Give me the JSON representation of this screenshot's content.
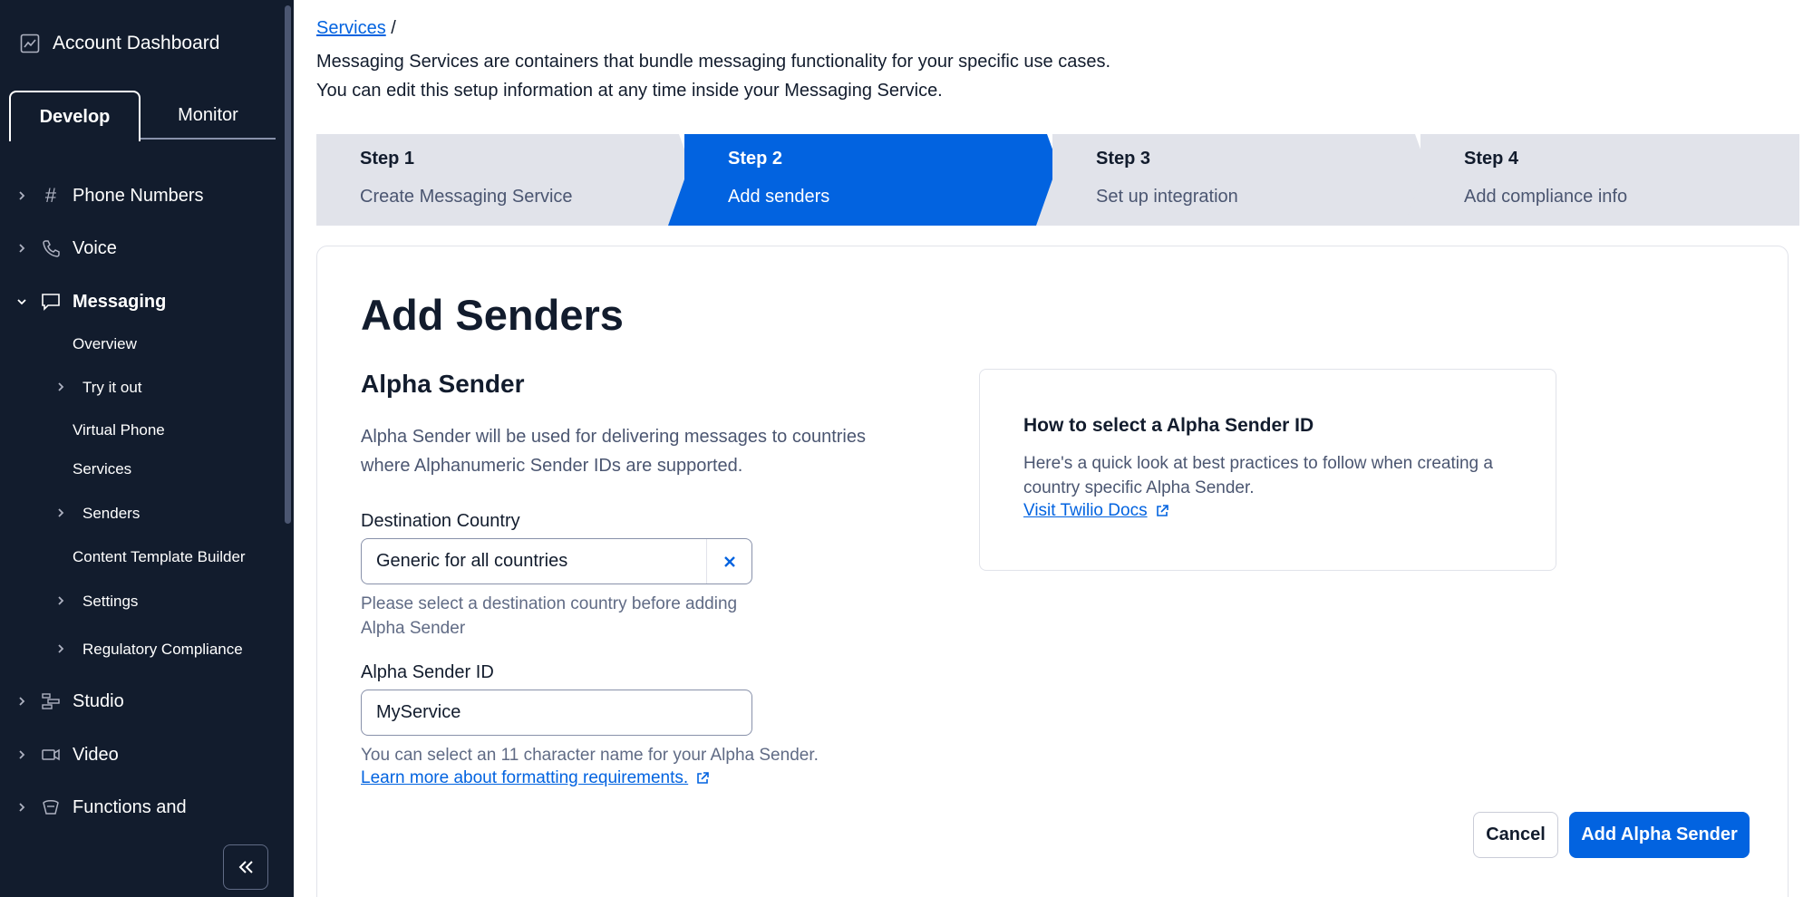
{
  "sidebar": {
    "account_label": "Account Dashboard",
    "tabs": [
      {
        "label": "Develop"
      },
      {
        "label": "Monitor"
      }
    ],
    "items": [
      {
        "label": "Phone Numbers",
        "icon": "hash-icon"
      },
      {
        "label": "Voice",
        "icon": "phone-icon"
      },
      {
        "label": "Messaging",
        "icon": "chat-icon"
      },
      {
        "label": "Studio",
        "icon": "studio-icon"
      },
      {
        "label": "Video",
        "icon": "video-icon"
      },
      {
        "label": "Functions and",
        "icon": "functions-icon"
      }
    ],
    "messaging_sub": [
      {
        "label": "Overview"
      },
      {
        "label": "Try it out"
      },
      {
        "label": "Virtual Phone"
      },
      {
        "label": "Services"
      },
      {
        "label": "Senders"
      },
      {
        "label": "Content Template Builder"
      },
      {
        "label": "Settings"
      },
      {
        "label": "Regulatory Compliance"
      }
    ]
  },
  "breadcrumb": {
    "link": "Services",
    "separator": "/"
  },
  "intro": {
    "line1": "Messaging Services are containers that bundle messaging functionality for your specific use cases.",
    "line2": "You can edit this setup information at any time inside your Messaging Service."
  },
  "steps": [
    {
      "num": "Step 1",
      "name": "Create Messaging Service"
    },
    {
      "num": "Step 2",
      "name": "Add senders"
    },
    {
      "num": "Step 3",
      "name": "Set up integration"
    },
    {
      "num": "Step 4",
      "name": "Add compliance info"
    }
  ],
  "card": {
    "title": "Add Senders",
    "section_title": "Alpha Sender",
    "description": "Alpha Sender will be used for delivering messages to countries where Alphanumeric Sender IDs are supported.",
    "country_label": "Destination Country",
    "country_value": "Generic for all countries",
    "country_help": "Please select a destination country before adding Alpha Sender",
    "sender_label": "Alpha Sender ID",
    "sender_value": "MyService",
    "sender_help": "You can select an 11 character name for your Alpha Sender.",
    "sender_link": "Learn more about formatting requirements.",
    "info_title": "How to select a Alpha Sender ID",
    "info_text": "Here's a quick look at best practices to follow when creating a country specific Alpha Sender.",
    "info_link": "Visit Twilio Docs",
    "cancel_label": "Cancel",
    "add_label": "Add Alpha Sender"
  },
  "colors": {
    "sidebar_bg": "#121c2d",
    "accent": "#0263e0",
    "step_inactive": "#e1e3ea"
  }
}
